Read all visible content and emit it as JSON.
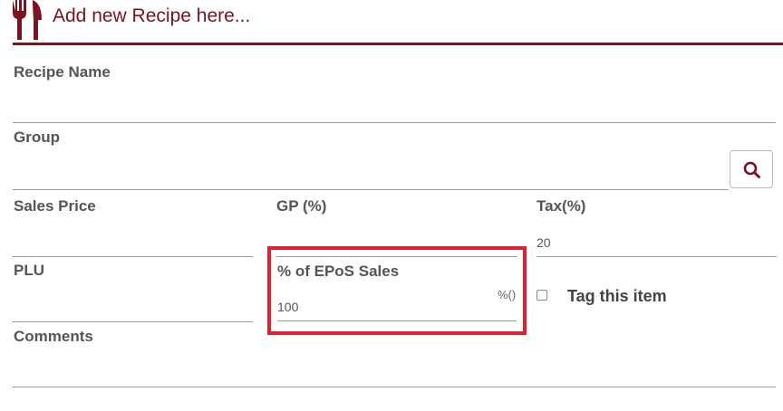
{
  "header": {
    "title": "Add new Recipe here...",
    "icon": "fork-knife-icon"
  },
  "form": {
    "recipe_name": {
      "label": "Recipe Name",
      "value": ""
    },
    "group": {
      "label": "Group",
      "value": "",
      "search_icon": "search-icon"
    },
    "sales_price": {
      "label": "Sales Price",
      "value": ""
    },
    "gp": {
      "label": "GP (%)",
      "value": ""
    },
    "tax": {
      "label": "Tax(%)",
      "value": "20"
    },
    "plu": {
      "label": "PLU",
      "value": ""
    },
    "epos_sales": {
      "label": "% of EPoS Sales",
      "value": "100",
      "suffix": "%()"
    },
    "tag": {
      "label": "Tag this item",
      "checked": false
    },
    "comments": {
      "label": "Comments",
      "value": ""
    }
  },
  "colors": {
    "accent": "#7a1220",
    "highlight": "#e0202c"
  }
}
